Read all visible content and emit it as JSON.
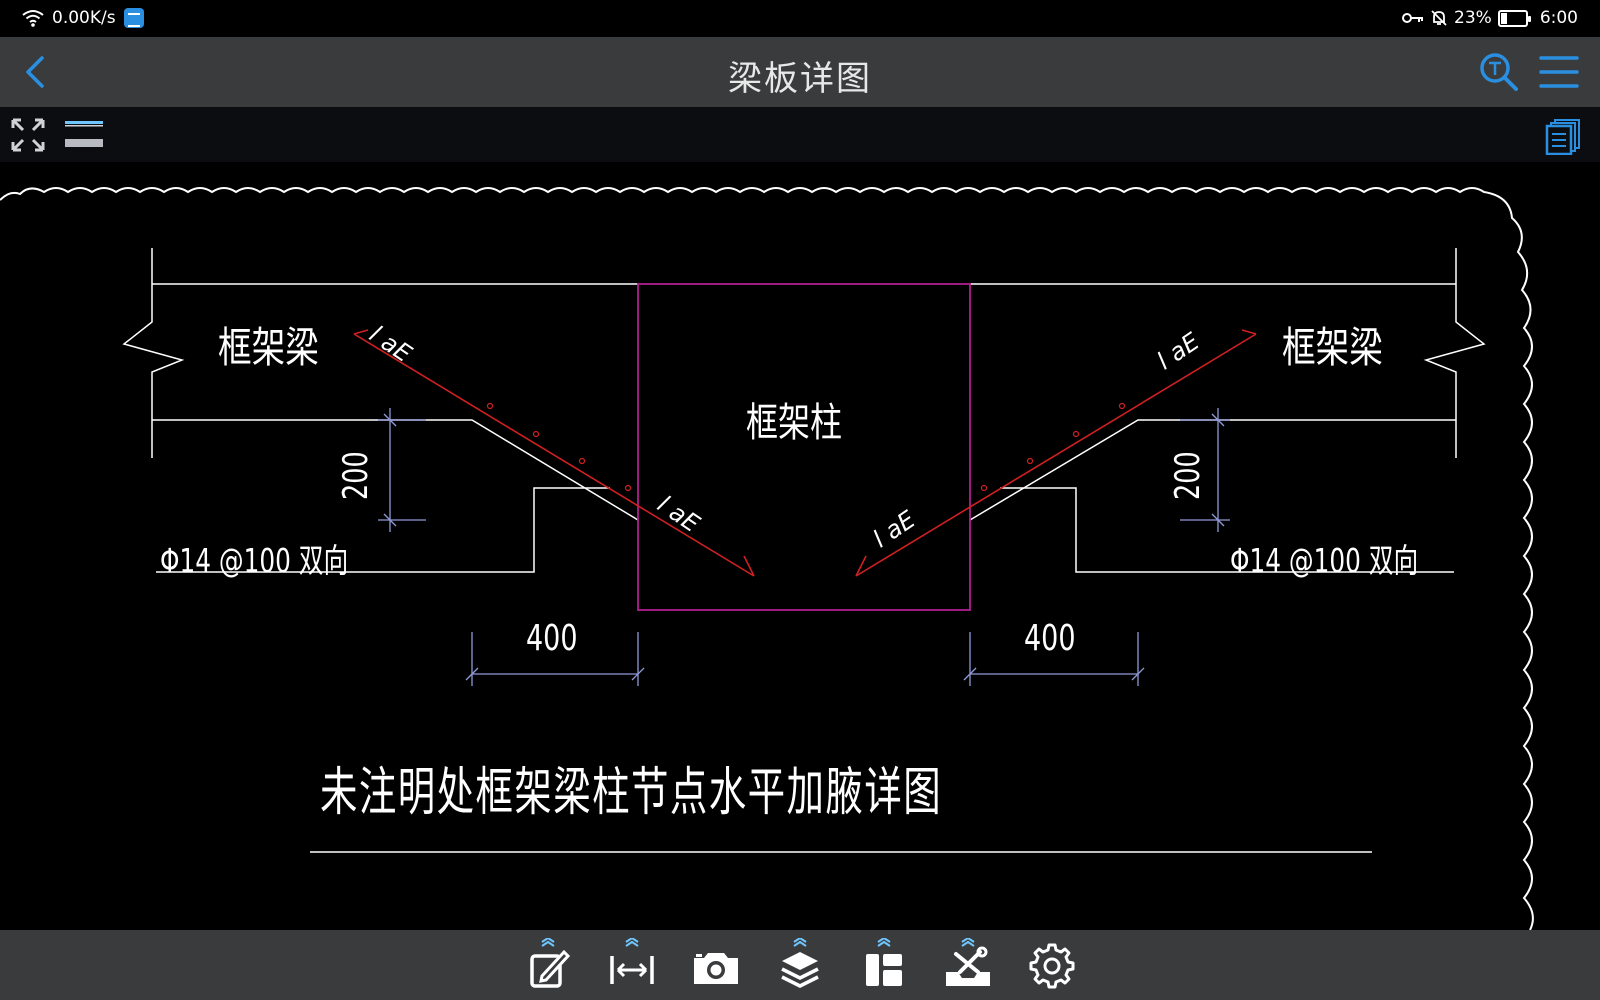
{
  "status": {
    "net_speed": "0.00K/s",
    "battery_pct": "23%",
    "battery_level": 0.23,
    "time": "6:00"
  },
  "titlebar": {
    "title": "梁板详图"
  },
  "drawing": {
    "beam_left": "框架梁",
    "beam_right": "框架梁",
    "column": "框架柱",
    "rebar_left": "Φ14 @100 双向",
    "rebar_right": "Φ14 @100 双向",
    "dim_width_left": "400",
    "dim_width_right": "400",
    "dim_height_left": "200",
    "dim_height_right": "200",
    "anchor_1": "l aE",
    "anchor_2": "l aE",
    "anchor_3": "l aE",
    "anchor_4": "l aE",
    "caption": "未注明处框架梁柱节点水平加腋详图"
  },
  "colors": {
    "rebar": "#d02020",
    "column_outline": "#b0208f",
    "dimension": "#8f9ad8",
    "accent": "#2a8fe0"
  },
  "icons": {
    "back": "back-chevron-icon",
    "search": "text-search-icon",
    "menu": "hamburger-menu-icon",
    "expand": "fullscreen-expand-icon",
    "layers": "layer-toggle-icon",
    "pages": "pages-list-icon",
    "toolbar": [
      "edit-icon",
      "measure-icon",
      "camera-icon",
      "layers-icon",
      "layout-icon",
      "tools-icon",
      "settings-icon"
    ]
  }
}
